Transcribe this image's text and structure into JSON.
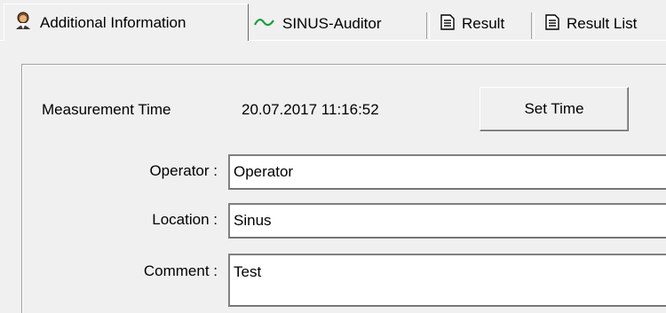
{
  "tabs": [
    {
      "label": "Additional Information",
      "icon": "user-icon",
      "active": true
    },
    {
      "label": "SINUS-Auditor",
      "icon": "sine-wave-icon",
      "active": false
    },
    {
      "label": "Result",
      "icon": "document-icon",
      "active": false
    },
    {
      "label": "Result List",
      "icon": "document-icon",
      "active": false
    }
  ],
  "measurement": {
    "label": "Measurement Time",
    "value": "20.07.2017 11:16:52",
    "set_time_label": "Set Time"
  },
  "fields": {
    "operator": {
      "label": "Operator :",
      "value": "Operator"
    },
    "location": {
      "label": "Location :",
      "value": "Sinus"
    },
    "comment": {
      "label": "Comment :",
      "value": "Test"
    }
  },
  "colors": {
    "sine_wave": "#1a9e3a",
    "window_bg": "#f0f0f0"
  }
}
